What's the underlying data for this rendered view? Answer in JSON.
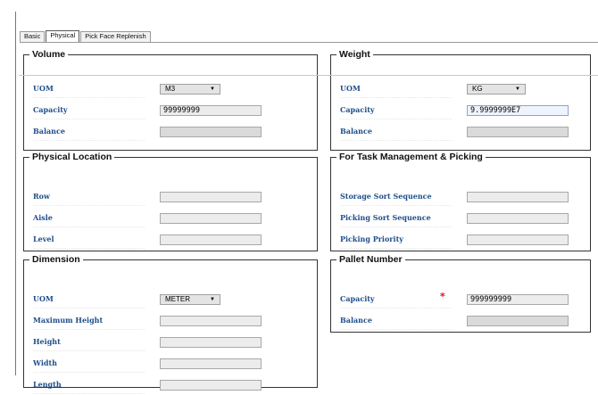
{
  "tabs": [
    {
      "label": "Basic",
      "active": false
    },
    {
      "label": "Physical",
      "active": true
    },
    {
      "label": "Pick Face Replenish",
      "active": false
    }
  ],
  "volume": {
    "legend": "Volume",
    "uom_label": "UOM",
    "uom_value": "M3",
    "capacity_label": "Capacity",
    "capacity_value": "99999999",
    "balance_label": "Balance",
    "balance_value": ""
  },
  "weight": {
    "legend": "Weight",
    "uom_label": "UOM",
    "uom_value": "KG",
    "capacity_label": "Capacity",
    "capacity_value": "9.9999999E7",
    "balance_label": "Balance",
    "balance_value": ""
  },
  "physical_location": {
    "legend": "Physical Location",
    "row_label": "Row",
    "row_value": "",
    "aisle_label": "Aisle",
    "aisle_value": "",
    "level_label": "Level",
    "level_value": ""
  },
  "task_management": {
    "legend": "For Task Management & Picking",
    "storage_label": "Storage Sort Sequence",
    "storage_value": "",
    "picking_sort_label": "Picking Sort Sequence",
    "picking_sort_value": "",
    "priority_label": "Picking Priority",
    "priority_value": ""
  },
  "dimension": {
    "legend": "Dimension",
    "uom_label": "UOM",
    "uom_value": "METER",
    "max_height_label": "Maximum Height",
    "max_height_value": "",
    "height_label": "Height",
    "height_value": "",
    "width_label": "Width",
    "width_value": "",
    "length_label": "Length",
    "length_value": ""
  },
  "pallet_number": {
    "legend": "Pallet Number",
    "capacity_label": "Capacity",
    "capacity_value": "999999999",
    "balance_label": "Balance",
    "balance_value": ""
  },
  "colors": {
    "label_blue": "#1f4e8a",
    "required_red": "#dd1111"
  },
  "icons": {
    "dropdown": "triangle-down",
    "required": "asterisk"
  }
}
